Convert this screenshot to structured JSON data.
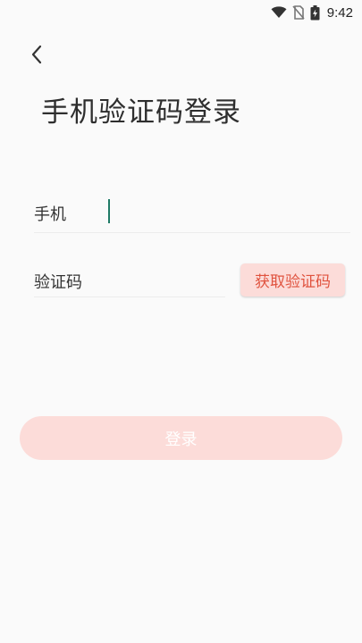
{
  "status_bar": {
    "time": "9:42",
    "icons": [
      "wifi-icon",
      "no-sim-icon",
      "battery-charging-icon"
    ]
  },
  "header": {
    "back_icon": "chevron-left-icon",
    "title": "手机验证码登录"
  },
  "form": {
    "phone_label": "手机",
    "phone_value": "",
    "code_label": "验证码",
    "code_value": "",
    "get_code_label": "获取验证码"
  },
  "actions": {
    "login_label": "登录"
  },
  "colors": {
    "accent": "#e0533f",
    "accent_light": "#fcdcd9",
    "caret": "#1f7a66",
    "background": "#fafafa"
  }
}
